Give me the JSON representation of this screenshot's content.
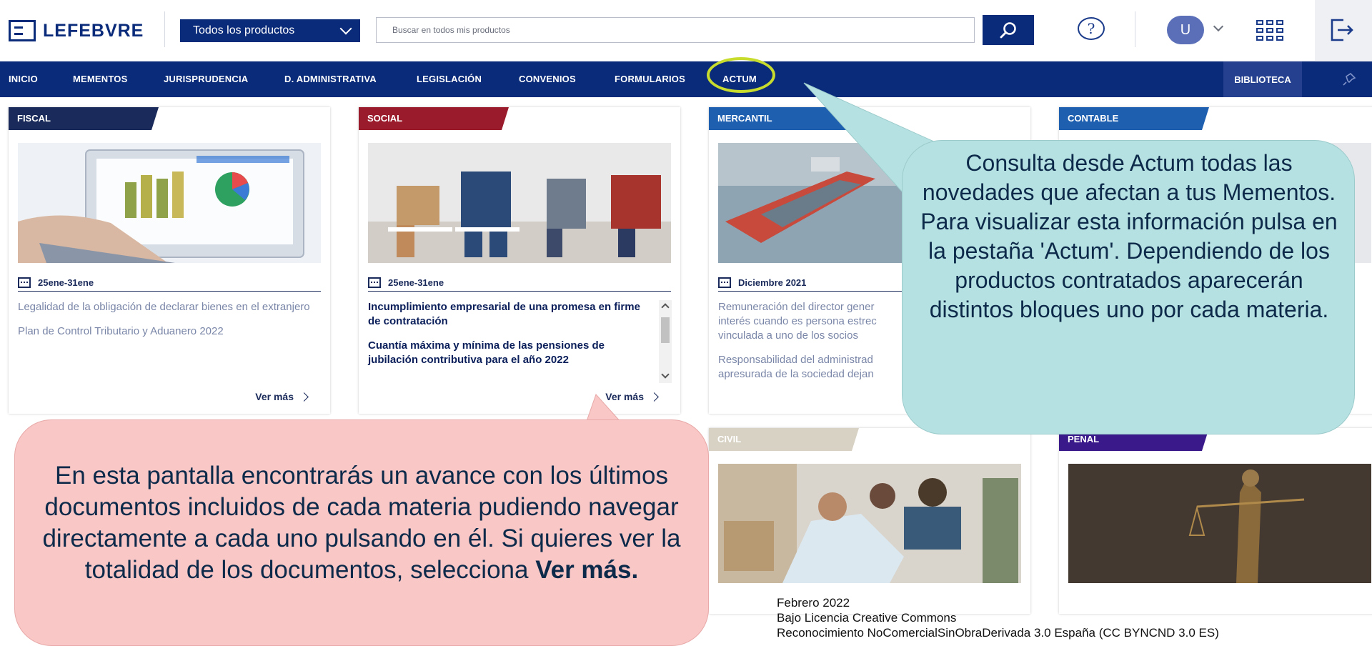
{
  "header": {
    "logo": "LEFEBVRE",
    "product_selector": "Todos los productos",
    "search_placeholder": "Buscar en todos mis productos",
    "avatar_initial": "U"
  },
  "nav": {
    "items": [
      "INICIO",
      "MEMENTOS",
      "JURISPRUDENCIA",
      "D. ADMINISTRATIVA",
      "LEGISLACIÓN",
      "CONVENIOS",
      "FORMULARIOS",
      "ACTUM"
    ],
    "biblioteca": "BIBLIOTECA"
  },
  "cards": [
    {
      "tag": "FISCAL",
      "tag_color": "#1a2a5a",
      "image": "computer-charts-image",
      "date": "25ene-31ene",
      "links": [
        "Legalidad de la obligación de declarar bienes en el extranjero",
        "Plan de Control Tributario y Aduanero 2022"
      ],
      "ver_mas": "Ver más"
    },
    {
      "tag": "SOCIAL",
      "tag_color": "#9a1c2c",
      "image": "people-waiting-image",
      "date": "25ene-31ene",
      "links": [
        "Incumplimiento empresarial de una promesa en firme de contratación",
        "Cuantía máxima y mínima de las pensiones de jubilación contributiva para el año 2022"
      ],
      "ver_mas": "Ver más"
    },
    {
      "tag": "MERCANTIL",
      "tag_color": "#1f5fb0",
      "image": "cargo-ship-image",
      "date": "Diciembre 2021",
      "links": [
        "Remuneración del director gener",
        "interés cuando es persona estrec",
        "vinculada a uno de los socios",
        "Responsabilidad del administrad",
        "apresurada de la sociedad dejan"
      ]
    },
    {
      "tag": "CONTABLE",
      "tag_color": "#1f5fb0"
    },
    {
      "tag": "CIVIL",
      "tag_color": "#d8d2c4",
      "image": "family-reading-image"
    },
    {
      "tag": "PENAL",
      "tag_color": "#3a1a8a",
      "image": "justice-statue-image"
    }
  ],
  "callouts": {
    "actum": "Consulta desde Actum todas las novedades que afectan a tus Mementos. Para visualizar esta información pulsa en la pestaña 'Actum'. Dependiendo de los productos contratados aparecerán distintos bloques uno por cada materia.",
    "avance_main": "En esta pantalla encontrarás un avance con los últimos documentos incluidos de cada materia pudiendo navegar directamente a cada uno pulsando en él. Si quieres ver la totalidad de los documentos, selecciona",
    "avance_bold": "Ver más."
  },
  "license": {
    "date": "Febrero 2022",
    "line1": "Bajo Licencia Creative Commons",
    "line2": "Reconocimiento NoComercialSinObraDerivada 3.0 España (CC BYNCND 3.0 ES)"
  }
}
